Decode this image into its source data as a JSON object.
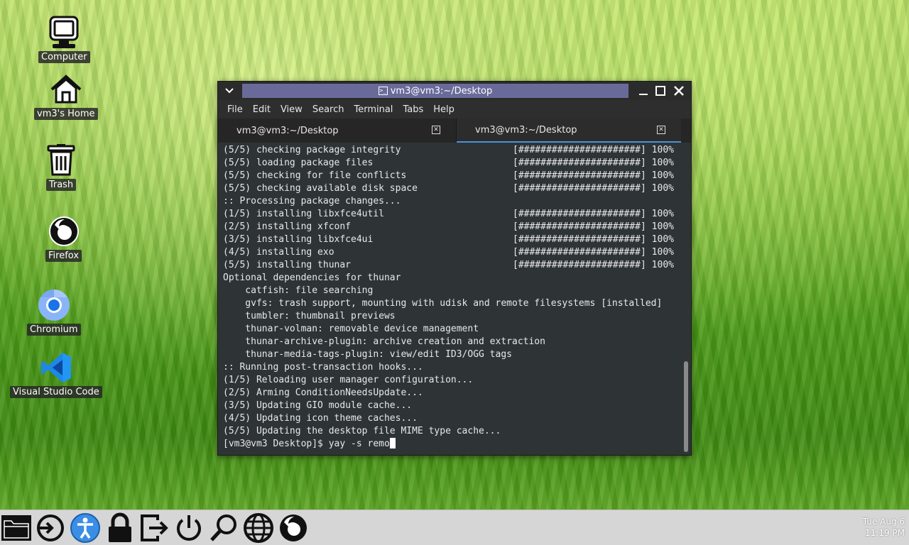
{
  "desktop": {
    "icons": [
      {
        "label": "Computer",
        "icon": "computer-icon"
      },
      {
        "label": "vm3's Home",
        "icon": "home-icon"
      },
      {
        "label": "Trash",
        "icon": "trash-icon"
      },
      {
        "label": "Firefox",
        "icon": "firefox-icon"
      },
      {
        "label": "Chromium",
        "icon": "chromium-icon"
      },
      {
        "label": "Visual Studio Code",
        "icon": "vscode-icon"
      }
    ]
  },
  "window": {
    "title": "vm3@vm3:~/Desktop",
    "menu": [
      "File",
      "Edit",
      "View",
      "Search",
      "Terminal",
      "Tabs",
      "Help"
    ],
    "tabs": [
      {
        "label": "vm3@vm3:~/Desktop",
        "active": false
      },
      {
        "label": "vm3@vm3:~/Desktop",
        "active": true
      }
    ],
    "terminal_lines": [
      {
        "text": "(5/5) checking package integrity",
        "bar": "[######################] 100%"
      },
      {
        "text": "(5/5) loading package files",
        "bar": "[######################] 100%"
      },
      {
        "text": "(5/5) checking for file conflicts",
        "bar": "[######################] 100%"
      },
      {
        "text": "(5/5) checking available disk space",
        "bar": "[######################] 100%"
      },
      {
        "text": ":: Processing package changes..."
      },
      {
        "text": "(1/5) installing libxfce4util",
        "bar": "[######################] 100%"
      },
      {
        "text": "(2/5) installing xfconf",
        "bar": "[######################] 100%"
      },
      {
        "text": "(3/5) installing libxfce4ui",
        "bar": "[######################] 100%"
      },
      {
        "text": "(4/5) installing exo",
        "bar": "[######################] 100%"
      },
      {
        "text": "(5/5) installing thunar",
        "bar": "[######################] 100%"
      },
      {
        "text": "Optional dependencies for thunar"
      },
      {
        "text": "    catfish: file searching"
      },
      {
        "text": "    gvfs: trash support, mounting with udisk and remote filesystems [installed]"
      },
      {
        "text": "    tumbler: thumbnail previews"
      },
      {
        "text": "    thunar-volman: removable device management"
      },
      {
        "text": "    thunar-archive-plugin: archive creation and extraction"
      },
      {
        "text": "    thunar-media-tags-plugin: view/edit ID3/OGG tags"
      },
      {
        "text": ":: Running post-transaction hooks..."
      },
      {
        "text": "(1/5) Reloading user manager configuration..."
      },
      {
        "text": "(2/5) Arming ConditionNeedsUpdate..."
      },
      {
        "text": "(3/5) Updating GIO module cache..."
      },
      {
        "text": "(4/5) Updating icon theme caches..."
      },
      {
        "text": "(5/5) Updating the desktop file MIME type cache..."
      }
    ],
    "prompt": "[vm3@vm3 Desktop]$ ",
    "command": "yay -s remo"
  },
  "taskbar": {
    "icons": [
      "file-manager-icon",
      "logout-icon",
      "accessibility-icon",
      "lock-icon",
      "exit-icon",
      "power-icon",
      "search-icon",
      "web-browser-icon",
      "firefox-icon"
    ],
    "clock_date": "Tue Aug  6",
    "clock_time": "11:19 PM"
  }
}
